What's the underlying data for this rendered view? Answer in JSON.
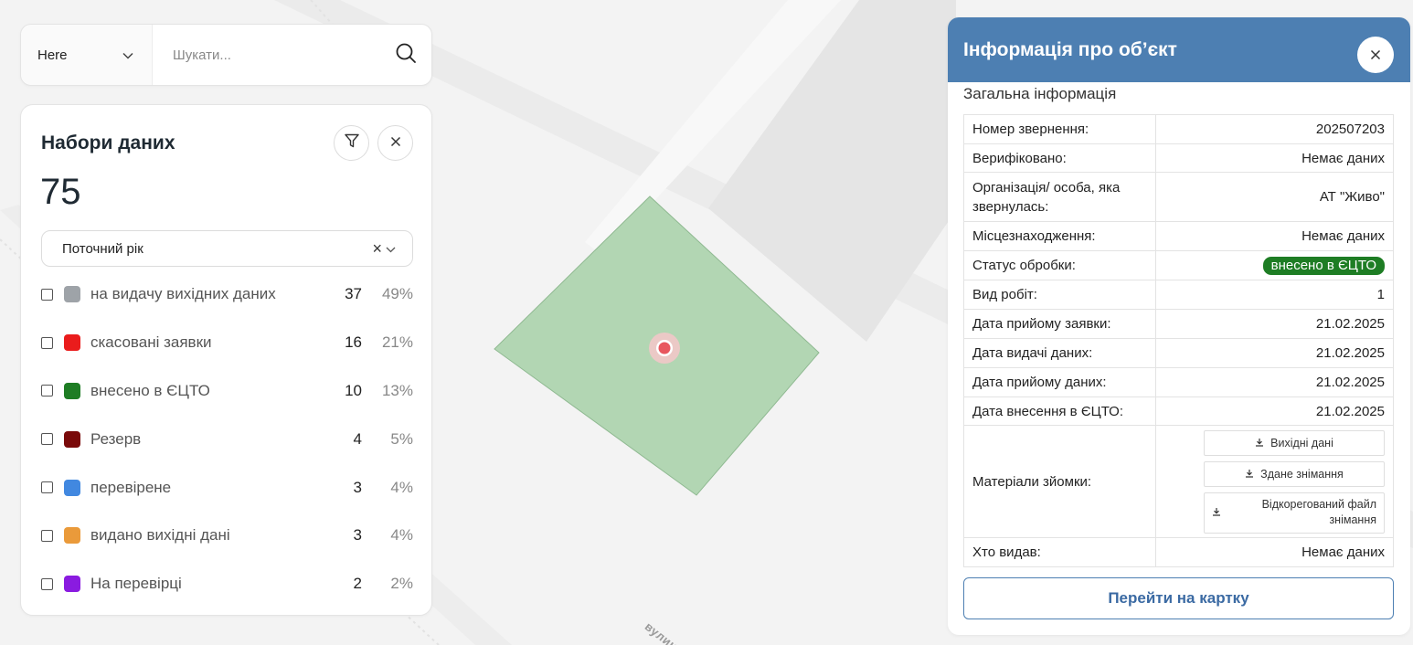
{
  "map": {
    "street_label": "вулиця",
    "parcel_color": "#b2d6b3",
    "marker_color": "#e8575f"
  },
  "search": {
    "provider": "Here",
    "placeholder": "Шукати...",
    "icon": "search-icon"
  },
  "datasets": {
    "title": "Набори даних",
    "total": "75",
    "year_filter": "Поточний рік",
    "filter_icon": "filter-icon",
    "close_icon": "close-icon",
    "items": [
      {
        "label": "на видачу вихідних даних",
        "count": "37",
        "percent": "49%",
        "color": "#9ea3a8"
      },
      {
        "label": "скасовані заявки",
        "count": "16",
        "percent": "21%",
        "color": "#ea1c1c"
      },
      {
        "label": "внесено в ЄЦТО",
        "count": "10",
        "percent": "13%",
        "color": "#1e7d24"
      },
      {
        "label": "Резерв",
        "count": "4",
        "percent": "5%",
        "color": "#7a0a0a"
      },
      {
        "label": "перевірене",
        "count": "3",
        "percent": "4%",
        "color": "#4188e0"
      },
      {
        "label": "видано вихідні дані",
        "count": "3",
        "percent": "4%",
        "color": "#ea9a3a"
      },
      {
        "label": "На перевірці",
        "count": "2",
        "percent": "2%",
        "color": "#8a1be0"
      }
    ]
  },
  "info": {
    "title": "Інформація про об’єкт",
    "section": "Загальна інформація",
    "rows": {
      "request_no": {
        "label": "Номер звернення:",
        "value": "202507203"
      },
      "verified": {
        "label": "Верифіковано:",
        "value": "Немає даних"
      },
      "organization": {
        "label": "Організація/ особа, яка звернулась:",
        "value": "АТ \"Живо\""
      },
      "location": {
        "label": "Місцезнаходження:",
        "value": "Немає даних"
      },
      "status": {
        "label": "Статус обробки:",
        "value": "внесено в ЄЦТО"
      },
      "work_type": {
        "label": "Вид робіт:",
        "value": "1"
      },
      "accept_date": {
        "label": "Дата прийому заявки:",
        "value": "21.02.2025"
      },
      "issue_date": {
        "label": "Дата видачі даних:",
        "value": "21.02.2025"
      },
      "receive_date": {
        "label": "Дата прийому даних:",
        "value": "21.02.2025"
      },
      "entry_date": {
        "label": "Дата внесення в ЄЦТО:",
        "value": "21.02.2025"
      },
      "materials": {
        "label": "Матеріали зйомки:"
      },
      "issued_by": {
        "label": "Хто видав:",
        "value": "Немає даних"
      }
    },
    "downloads": {
      "source": "Вихідні дані",
      "survey": "Здане знімання",
      "corrected": "Відкорегований файл знімання"
    },
    "status_color": "#1e7d24",
    "go_to_card": "Перейти на картку"
  }
}
